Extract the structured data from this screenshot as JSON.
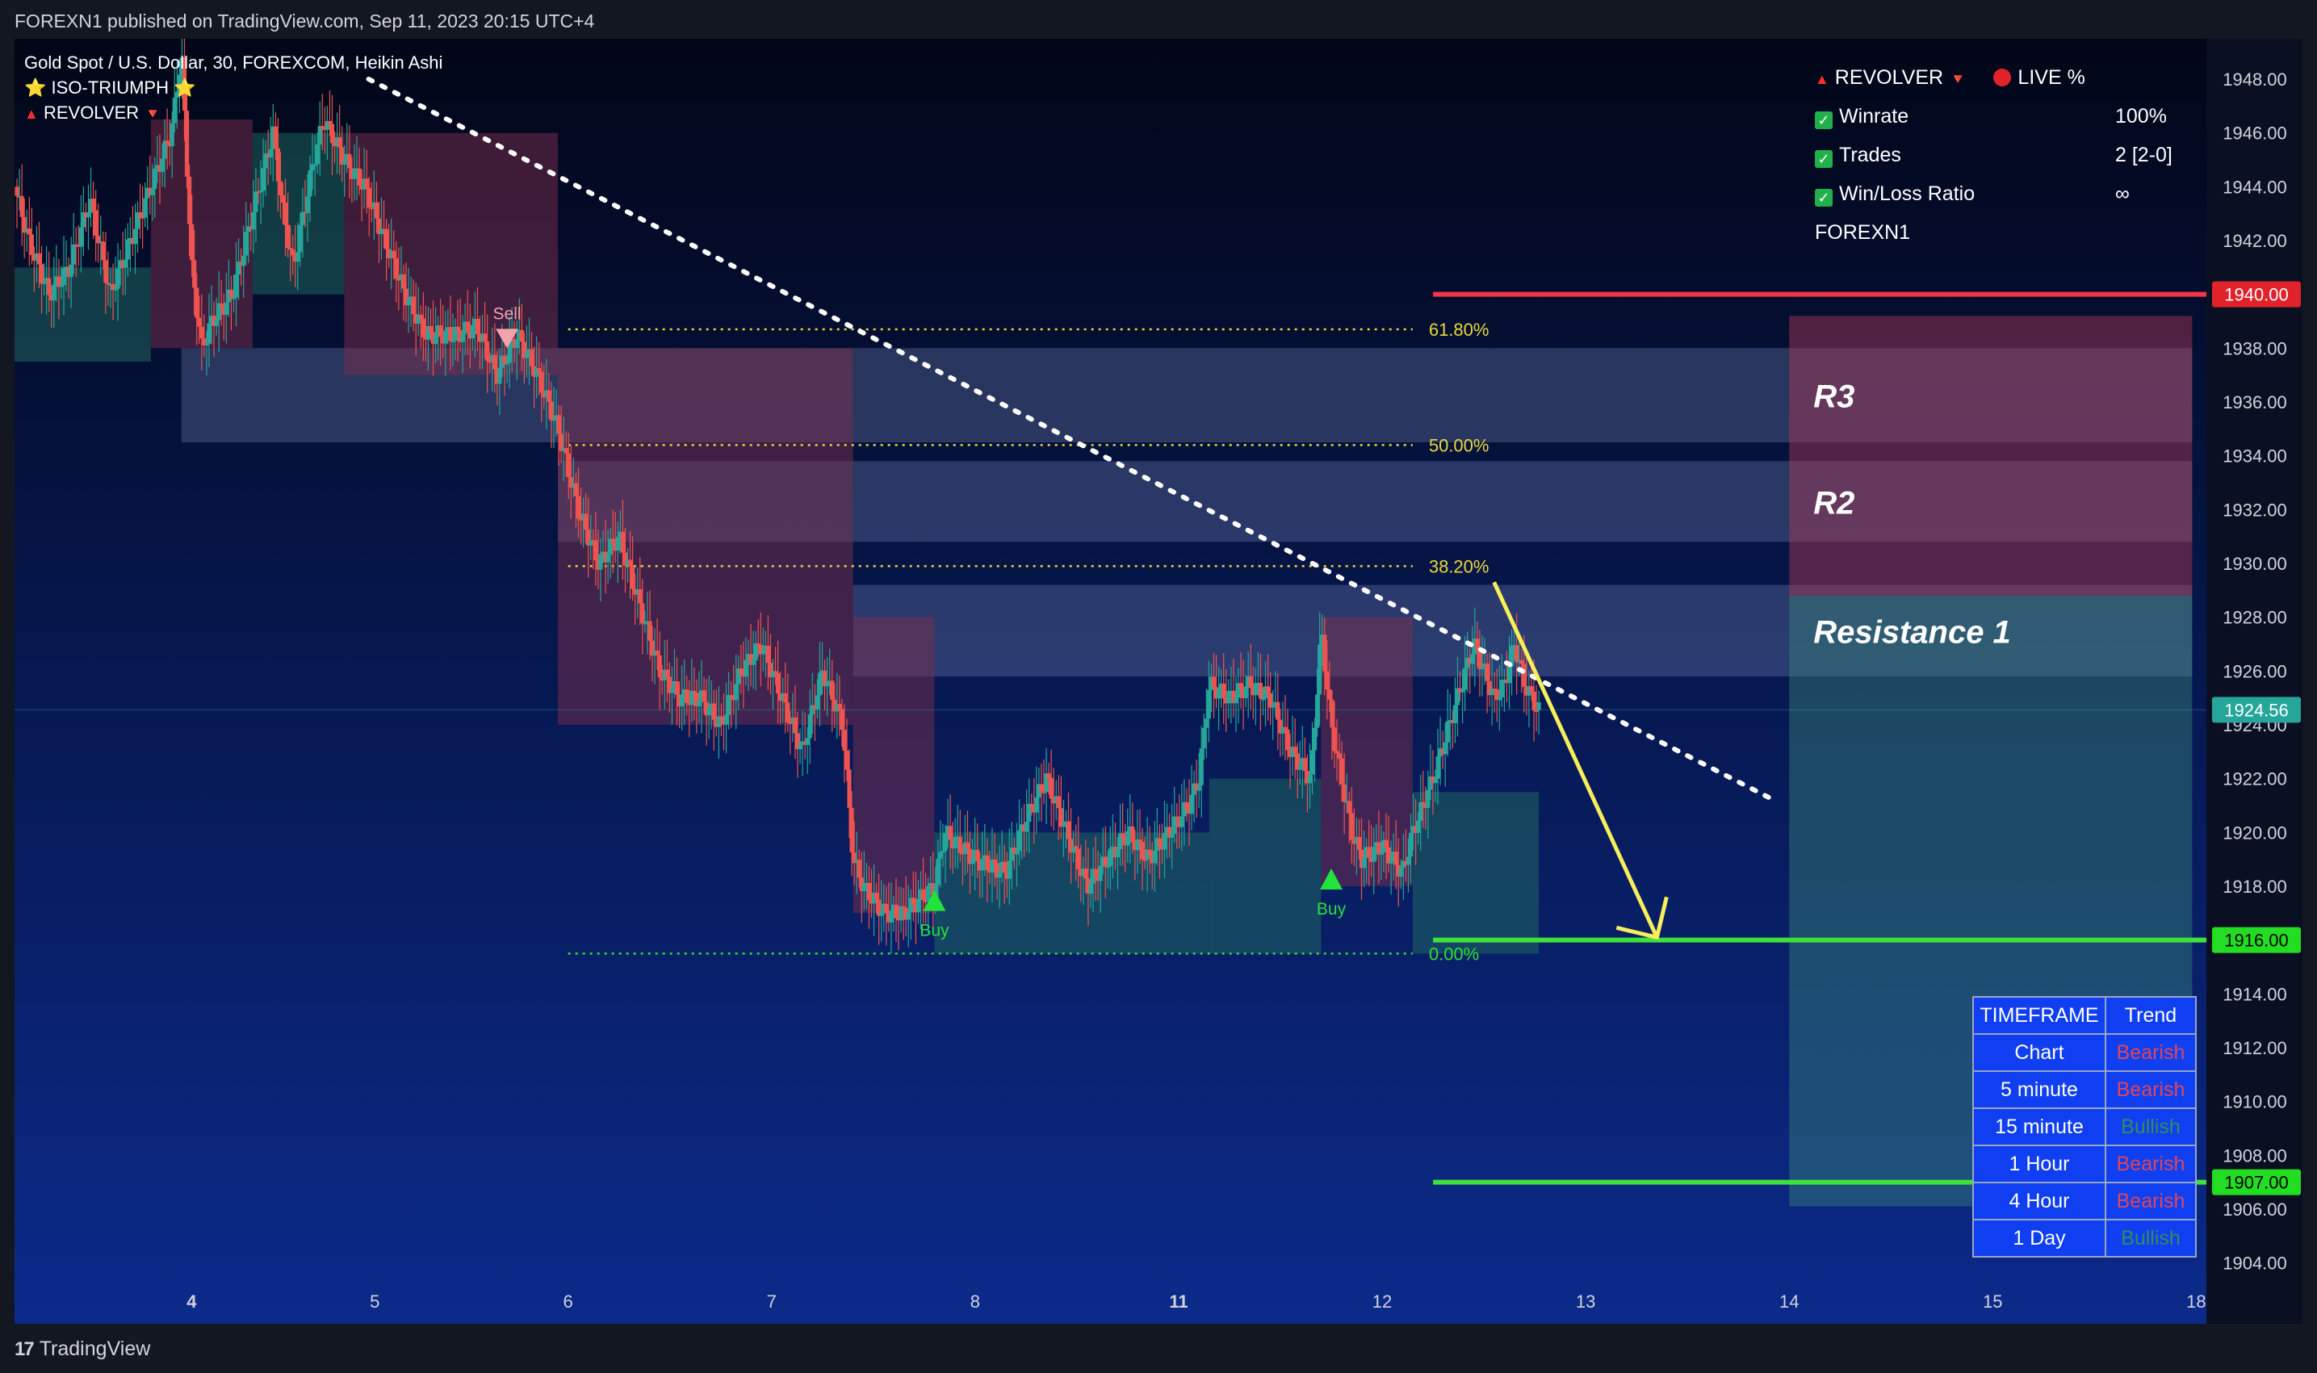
{
  "header": {
    "published": "FOREXN1 published on TradingView.com, Sep 11, 2023 20:15 UTC+4"
  },
  "footer": {
    "brand": "TradingView",
    "brand_icon": "tradingview-logo-icon"
  },
  "legend": {
    "symbol": "Gold Spot / U.S. Dollar, 30, FOREXCOM, Heikin Ashi",
    "indicator1": "ISO-TRIUMPH",
    "indicator2": "REVOLVER"
  },
  "stats_panel": {
    "title": "REVOLVER",
    "live": "LIVE %",
    "rows": [
      {
        "label": "Winrate",
        "value": "100%"
      },
      {
        "label": "Trades",
        "value": "2 [2-0]"
      },
      {
        "label": "Win/Loss Ratio",
        "value": "∞"
      }
    ],
    "author": "FOREXN1"
  },
  "timeframe_table": {
    "headers": [
      "TIMEFRAME",
      "Trend"
    ],
    "rows": [
      {
        "tf": "Chart",
        "trend": "Bearish"
      },
      {
        "tf": "5 minute",
        "trend": "Bearish"
      },
      {
        "tf": "15 minute",
        "trend": "Bullish"
      },
      {
        "tf": "1 Hour",
        "trend": "Bearish"
      },
      {
        "tf": "4 Hour",
        "trend": "Bearish"
      },
      {
        "tf": "1 Day",
        "trend": "Bullish"
      }
    ]
  },
  "colors": {
    "bull": "#26a69a",
    "bear": "#ef5350",
    "resistance_line": "#f23645",
    "support_line": "#3ee03a",
    "fib": "#e8d838",
    "arrow": "#f7ef5a",
    "background_top": "#020617",
    "background_bottom": "#0b2a8a"
  },
  "chart_data": {
    "type": "candlestick",
    "chart_style": "Heikin Ashi",
    "y_axis": {
      "min": 1903,
      "max": 1949.5,
      "ticks": [
        1904,
        1906,
        1908,
        1910,
        1912,
        1914,
        1916,
        1918,
        1920,
        1922,
        1924,
        1926,
        1928,
        1930,
        1932,
        1934,
        1936,
        1938,
        1940,
        1942,
        1944,
        1946,
        1948
      ]
    },
    "x_axis": {
      "labels": [
        {
          "day": 3.6,
          "text": "4"
        },
        {
          "day": 4.5,
          "text": "5"
        },
        {
          "day": 5.45,
          "text": "6"
        },
        {
          "day": 6.45,
          "text": "7"
        },
        {
          "day": 7.45,
          "text": "8"
        },
        {
          "day": 8.45,
          "text": "11"
        },
        {
          "day": 9.45,
          "text": "12"
        },
        {
          "day": 10.45,
          "text": "13"
        },
        {
          "day": 11.45,
          "text": "14"
        },
        {
          "day": 12.45,
          "text": "15"
        },
        {
          "day": 13.45,
          "text": "18"
        }
      ],
      "range": [
        2.73,
        13.5
      ]
    },
    "price_path": [
      [
        2.73,
        1944
      ],
      [
        2.8,
        1942
      ],
      [
        2.9,
        1940
      ],
      [
        3.0,
        1941
      ],
      [
        3.1,
        1943.5
      ],
      [
        3.2,
        1940
      ],
      [
        3.3,
        1942
      ],
      [
        3.4,
        1944
      ],
      [
        3.5,
        1946
      ],
      [
        3.55,
        1949
      ],
      [
        3.6,
        1941
      ],
      [
        3.65,
        1938
      ],
      [
        3.7,
        1939
      ],
      [
        3.8,
        1940
      ],
      [
        3.9,
        1943
      ],
      [
        4.0,
        1946
      ],
      [
        4.05,
        1943
      ],
      [
        4.1,
        1941
      ],
      [
        4.2,
        1945
      ],
      [
        4.25,
        1946.5
      ],
      [
        4.35,
        1945
      ],
      [
        4.45,
        1944
      ],
      [
        4.55,
        1942
      ],
      [
        4.65,
        1940
      ],
      [
        4.75,
        1938.5
      ],
      [
        4.9,
        1938.5
      ],
      [
        5.0,
        1938.8
      ],
      [
        5.1,
        1937
      ],
      [
        5.2,
        1938.5
      ],
      [
        5.3,
        1937
      ],
      [
        5.4,
        1935
      ],
      [
        5.5,
        1932
      ],
      [
        5.6,
        1930
      ],
      [
        5.7,
        1931
      ],
      [
        5.8,
        1928.5
      ],
      [
        5.9,
        1926
      ],
      [
        6.0,
        1925
      ],
      [
        6.1,
        1925
      ],
      [
        6.2,
        1924
      ],
      [
        6.3,
        1926
      ],
      [
        6.4,
        1927
      ],
      [
        6.5,
        1925
      ],
      [
        6.6,
        1923
      ],
      [
        6.7,
        1926
      ],
      [
        6.8,
        1924
      ],
      [
        6.85,
        1919
      ],
      [
        6.9,
        1918
      ],
      [
        7.0,
        1917
      ],
      [
        7.1,
        1917
      ],
      [
        7.25,
        1918
      ],
      [
        7.3,
        1920
      ],
      [
        7.45,
        1919
      ],
      [
        7.6,
        1918.5
      ],
      [
        7.7,
        1920.5
      ],
      [
        7.8,
        1922
      ],
      [
        7.9,
        1920
      ],
      [
        8.0,
        1918
      ],
      [
        8.1,
        1919
      ],
      [
        8.2,
        1920
      ],
      [
        8.3,
        1919
      ],
      [
        8.4,
        1920
      ],
      [
        8.5,
        1921
      ],
      [
        8.55,
        1922
      ],
      [
        8.6,
        1925.5
      ],
      [
        8.7,
        1925
      ],
      [
        8.8,
        1925.5
      ],
      [
        8.9,
        1925
      ],
      [
        9.0,
        1923
      ],
      [
        9.1,
        1922
      ],
      [
        9.15,
        1927.5
      ],
      [
        9.2,
        1924
      ],
      [
        9.25,
        1922
      ],
      [
        9.3,
        1920
      ],
      [
        9.35,
        1919
      ],
      [
        9.45,
        1919.5
      ],
      [
        9.5,
        1919
      ],
      [
        9.55,
        1918.5
      ],
      [
        9.6,
        1920
      ],
      [
        9.7,
        1922
      ],
      [
        9.8,
        1924.5
      ],
      [
        9.9,
        1927
      ],
      [
        9.95,
        1926
      ],
      [
        10.0,
        1925
      ],
      [
        10.05,
        1925.5
      ],
      [
        10.1,
        1927
      ],
      [
        10.15,
        1925.5
      ],
      [
        10.22,
        1924.5
      ]
    ],
    "overlay_band": [
      {
        "from": 2.73,
        "to": 3.4,
        "lower": 1937.5,
        "upper": 1941,
        "trend": "bull"
      },
      {
        "from": 3.4,
        "to": 3.9,
        "lower": 1938,
        "upper": 1946.5,
        "trend": "bear"
      },
      {
        "from": 3.9,
        "to": 4.35,
        "lower": 1940,
        "upper": 1946,
        "trend": "bull"
      },
      {
        "from": 4.35,
        "to": 5.4,
        "lower": 1937,
        "upper": 1946,
        "trend": "bear"
      },
      {
        "from": 5.4,
        "to": 6.85,
        "lower": 1924,
        "upper": 1938,
        "trend": "bear"
      },
      {
        "from": 6.85,
        "to": 7.25,
        "lower": 1917,
        "upper": 1928,
        "trend": "bear"
      },
      {
        "from": 7.25,
        "to": 8.6,
        "lower": 1915.5,
        "upper": 1920,
        "trend": "bull"
      },
      {
        "from": 8.6,
        "to": 9.15,
        "lower": 1915.5,
        "upper": 1922,
        "trend": "bull"
      },
      {
        "from": 9.15,
        "to": 9.6,
        "lower": 1918,
        "upper": 1928,
        "trend": "bear"
      },
      {
        "from": 9.6,
        "to": 10.22,
        "lower": 1915.5,
        "upper": 1921.5,
        "trend": "bull"
      }
    ],
    "zones": [
      {
        "name": "R3",
        "from_day": 3.55,
        "to_day": 13.43,
        "low": 1934.5,
        "high": 1938
      },
      {
        "name": "R2",
        "from_day": 5.4,
        "to_day": 13.43,
        "low": 1930.8,
        "high": 1933.8
      },
      {
        "name": "Resistance 1",
        "from_day": 6.85,
        "to_day": 13.43,
        "low": 1925.8,
        "high": 1929.2
      }
    ],
    "zone_labels": [
      "R3",
      "R2",
      "Resistance 1"
    ],
    "fib_levels": [
      {
        "label": "61.80%",
        "price": 1938.7
      },
      {
        "label": "50.00%",
        "price": 1934.4
      },
      {
        "label": "38.20%",
        "price": 1929.9
      },
      {
        "label": "0.00%",
        "price": 1915.5
      }
    ],
    "fib_range_days": [
      5.45,
      9.6
    ],
    "horizontal_lines": [
      {
        "price": 1940,
        "label": "1940.00",
        "color": "resistance",
        "from_day": 9.7
      },
      {
        "price": 1916,
        "label": "1916.00",
        "color": "support",
        "from_day": 9.7
      },
      {
        "price": 1907,
        "label": "1907.00",
        "color": "support",
        "from_day": 9.7
      }
    ],
    "last_price": {
      "price": 1924.56,
      "label": "1924.56"
    },
    "signals": [
      {
        "type": "Sell",
        "day": 5.15,
        "price": 1938.3
      },
      {
        "type": "Buy",
        "day": 7.25,
        "price": 1917.5
      },
      {
        "type": "Buy",
        "day": 9.2,
        "price": 1918.3
      }
    ],
    "trendline": {
      "from": [
        4.47,
        1948
      ],
      "to": [
        11.35,
        1921.3
      ]
    },
    "projection_arrow": {
      "from": [
        10.0,
        1929.3
      ],
      "to": [
        10.8,
        1916.1
      ]
    },
    "risk_box": {
      "from_day": 11.45,
      "to_day": 13.43,
      "entry": 1928.8,
      "stop": 1939.2,
      "target": 1906.1
    }
  }
}
